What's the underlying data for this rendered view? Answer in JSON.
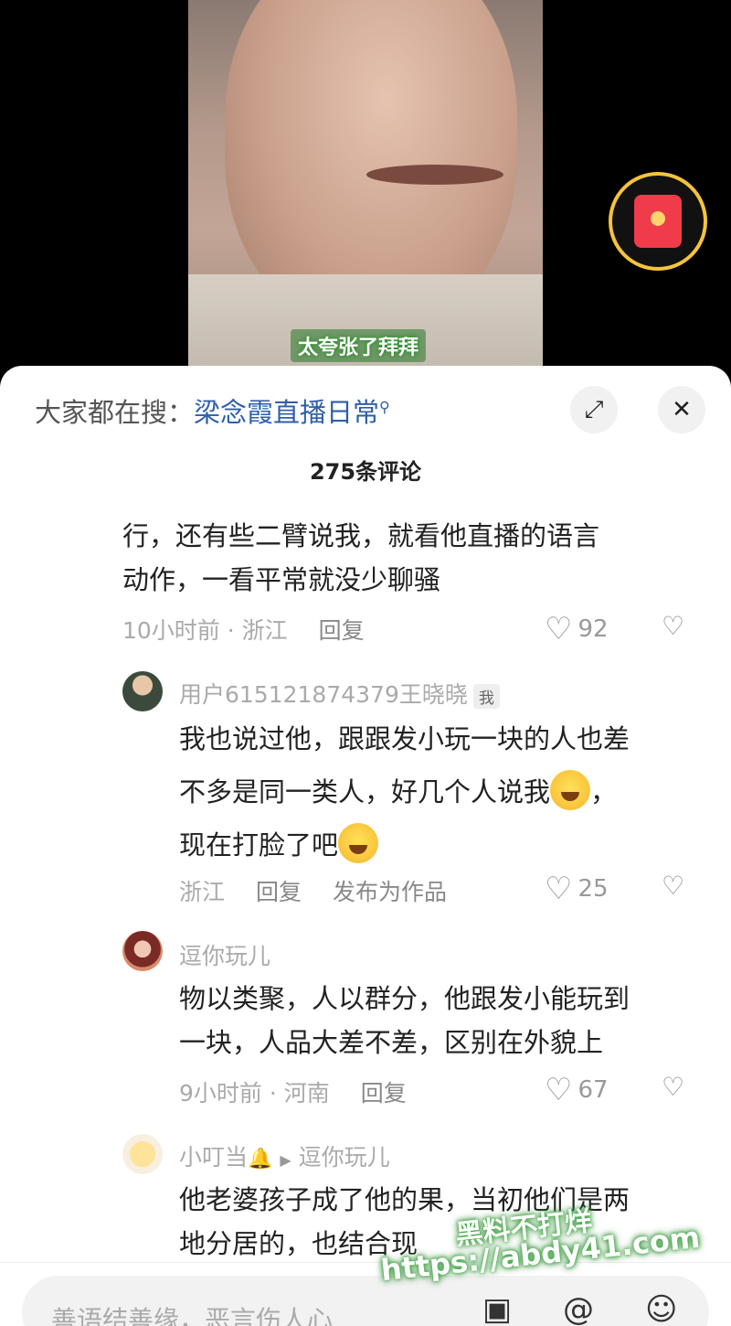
{
  "video": {
    "subtitle": "太夸张了拜拜"
  },
  "panel": {
    "search_prefix": "大家都在搜：",
    "search_link": "梁念霞直播日常",
    "comment_count": "275条评论"
  },
  "comments": [
    {
      "text_line1": "行，还有些二臂说我，就看他直播的语言",
      "text_line2": "动作，一看平常就没少聊骚",
      "meta": "10小时前 · 浙江",
      "reply": "回复",
      "likes": "92"
    },
    {
      "username": "用户615121874379王晓晓",
      "badge": "我",
      "text_line1": "我也说过他，跟跟发小玩一块的人也差",
      "text_line2a": "不多是同一类人，好几个人说我",
      "text_line2b": "，",
      "text_line3": "现在打脸了吧",
      "meta": "浙江",
      "reply": "回复",
      "publish": "发布为作品",
      "likes": "25"
    },
    {
      "username": "逗你玩儿",
      "text_line1": "物以类聚，人以群分，他跟发小能玩到",
      "text_line2": "一块，人品大差不差，区别在外貌上",
      "meta": "9小时前 · 河南",
      "reply": "回复",
      "likes": "67"
    },
    {
      "username": "小叮当",
      "reply_to": "逗你玩儿",
      "text_line1": "他老婆孩子成了他的果，当初他们是两",
      "text_line2": "地分居的，也结合现"
    }
  ],
  "input": {
    "placeholder": "善语结善缘，恶言伤人心"
  },
  "watermark": {
    "line1": "黑料不打烊",
    "line2": "https://abdy41.com"
  }
}
